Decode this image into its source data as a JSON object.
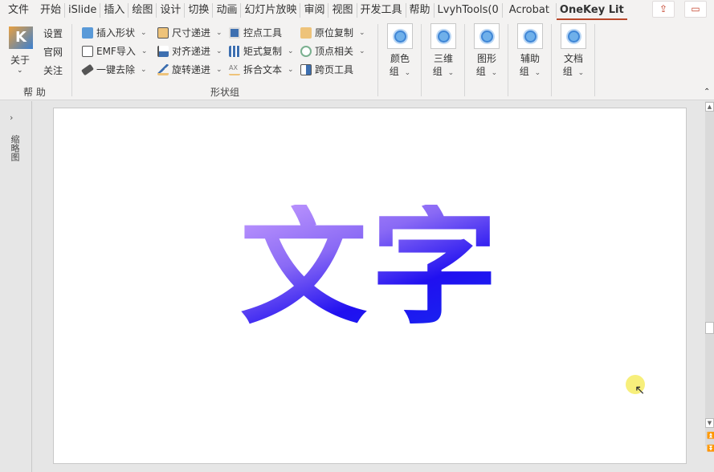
{
  "tabs": [
    "文件",
    "开始",
    "iSlide",
    "插入",
    "绘图",
    "设计",
    "切换",
    "动画",
    "幻灯片放映",
    "审阅",
    "视图",
    "开发工具",
    "帮助",
    "LvyhTools(0",
    "Acrobat",
    "OneKey Lit"
  ],
  "active_tab": "OneKey Lit",
  "help_group": {
    "about": "关于",
    "settings": "设置",
    "website": "官网",
    "follow": "关注",
    "label": "帮 助"
  },
  "shape_group": {
    "label": "形状组",
    "items": [
      "插入形状",
      "尺寸递进",
      "控点工具",
      "原位复制",
      "EMF导入",
      "对齐递进",
      "矩式复制",
      "顶点相关",
      "一键去除",
      "旋转递进",
      "拆合文本",
      "跨页工具"
    ]
  },
  "big_buttons": [
    {
      "l1": "颜色",
      "l2": "组"
    },
    {
      "l1": "三维",
      "l2": "组"
    },
    {
      "l1": "图形",
      "l2": "组"
    },
    {
      "l1": "辅助",
      "l2": "组"
    },
    {
      "l1": "文档",
      "l2": "组"
    }
  ],
  "thumbnail_pane": "缩略图",
  "slide_text": "文字",
  "colors": {
    "accent": "#b7472a"
  }
}
